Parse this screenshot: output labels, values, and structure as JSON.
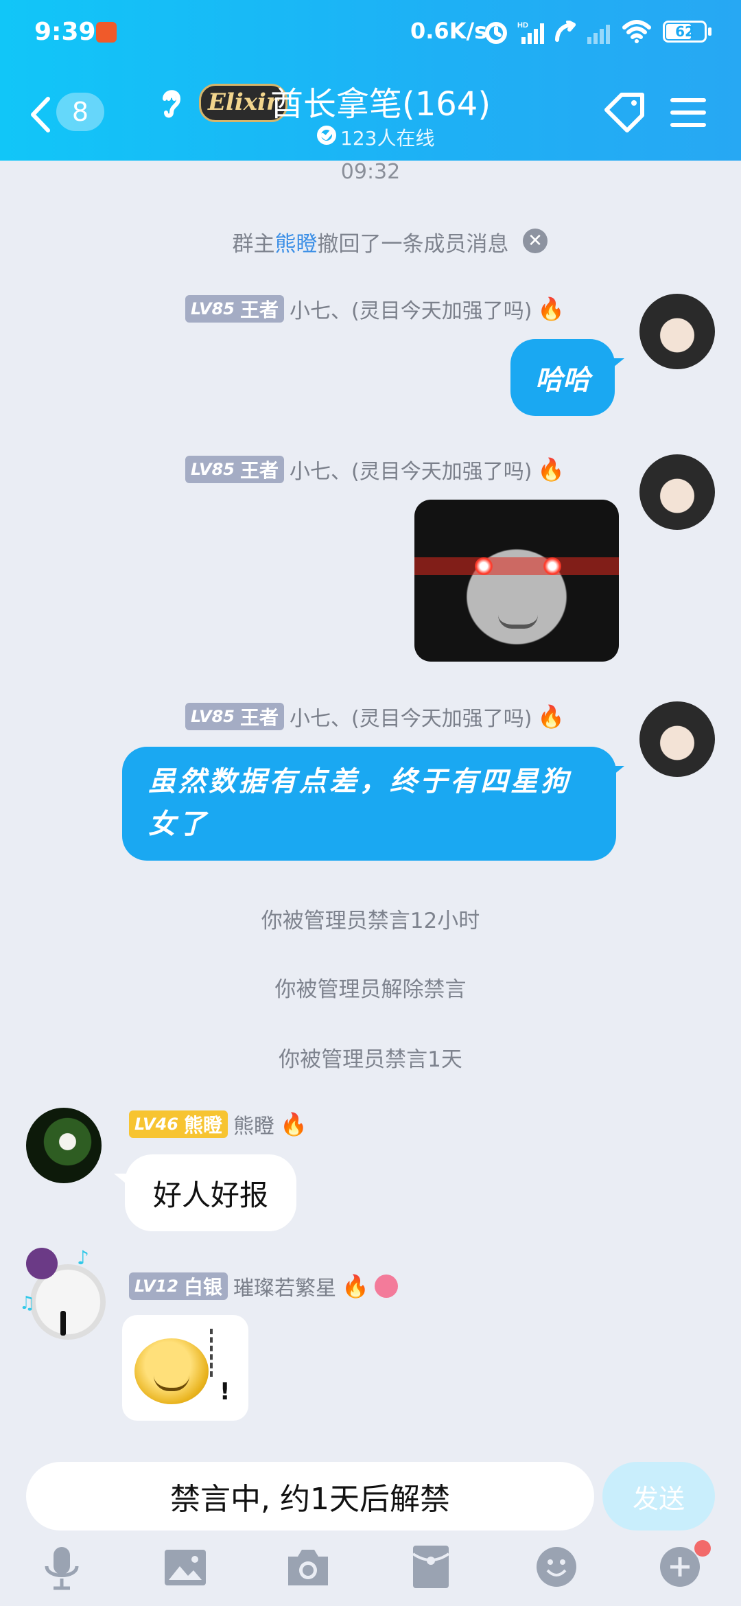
{
  "status_bar": {
    "time": "9:39",
    "net_speed": "0.6K/s",
    "hd_label": "HD",
    "battery": "62"
  },
  "header": {
    "back_count": "8",
    "group_logo_text": "Elixir",
    "group_name": "酋长拿笔(164)",
    "online": "123人在线"
  },
  "timestamp": "09:32",
  "recall_notice": {
    "prefix": "群主",
    "name": "熊瞪",
    "suffix": "撤回了一条成员消息"
  },
  "messages": [
    {
      "tag_lv": "LV85",
      "tag_title": "王者",
      "nick": "小七、(灵目今天加强了吗)",
      "text": "哈哈"
    },
    {
      "tag_lv": "LV85",
      "tag_title": "王者",
      "nick": "小七、(灵目今天加强了吗)",
      "image": "red-eyes-meme"
    },
    {
      "tag_lv": "LV85",
      "tag_title": "王者",
      "nick": "小七、(灵目今天加强了吗)",
      "text": "虽然数据有点差，终于有四星狗女了"
    },
    {
      "tag_lv": "LV46",
      "tag_title": "熊瞪",
      "nick": "熊瞪",
      "text": "好人好报"
    },
    {
      "tag_lv": "LV12",
      "tag_title": "白银",
      "nick": "璀璨若繁星",
      "image": "smiley-meme"
    }
  ],
  "system_notices": [
    "你被管理员禁言12小时",
    "你被管理员解除禁言",
    "你被管理员禁言1天"
  ],
  "input": {
    "muted_text": "禁言中, 约1天后解禁",
    "send_label": "发送"
  },
  "toolbar_icons": [
    "microphone-icon",
    "image-icon",
    "camera-icon",
    "red-packet-icon",
    "emoji-icon",
    "plus-icon"
  ],
  "colors": {
    "header": "#1eb0f5",
    "bubble": "#1aa8f2",
    "tag_wangzhe": "#a4acc4",
    "tag_gold": "#f7c431",
    "tag_baiyin": "#a4acc4",
    "link_name": "#3a8ee6",
    "background": "#eaedf4"
  }
}
